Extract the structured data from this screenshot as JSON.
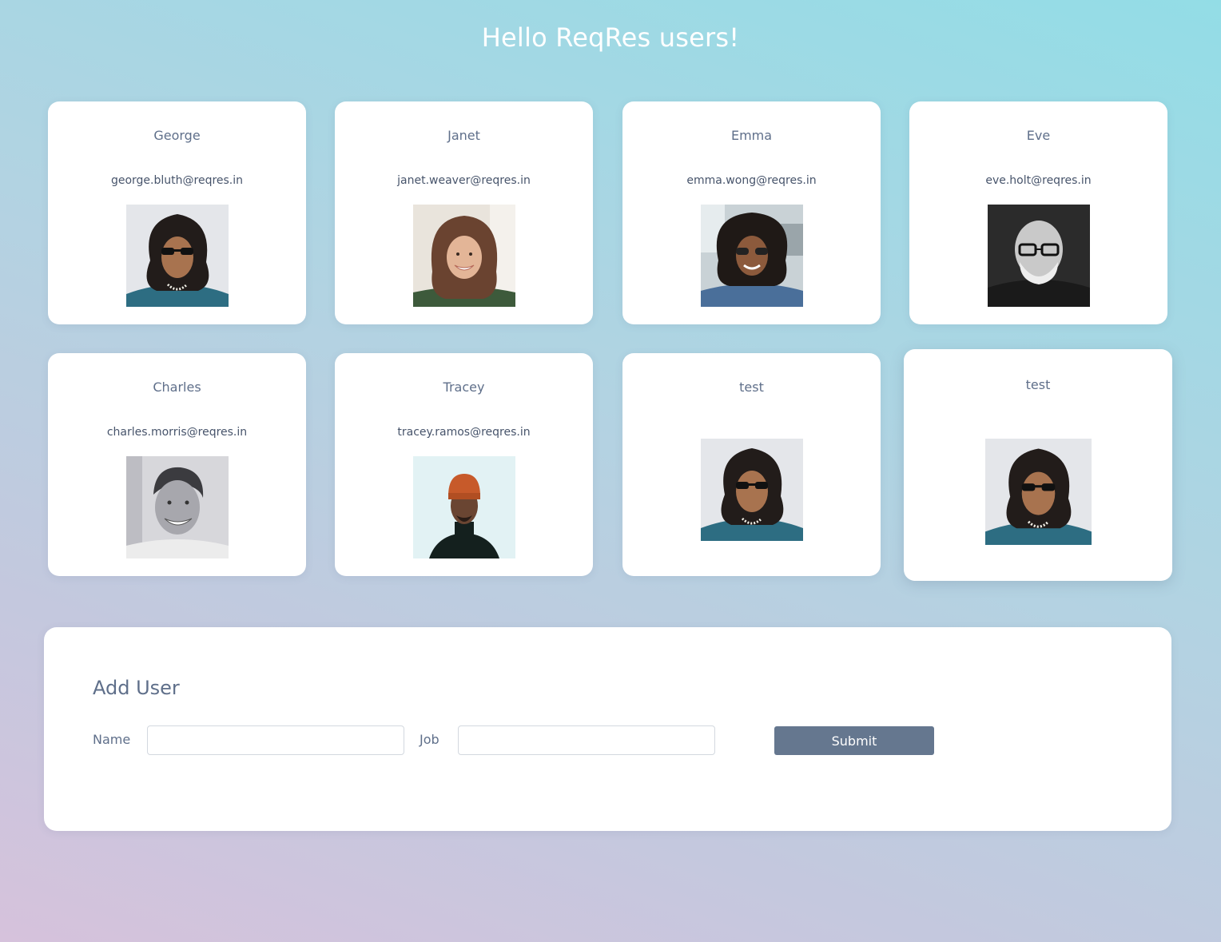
{
  "page": {
    "title": "Hello ReqRes users!"
  },
  "users": [
    {
      "first_name": "George",
      "email": "george.bluth@reqres.in",
      "avatar_icon": "avatar-curly-hair-sunglasses-photo"
    },
    {
      "first_name": "Janet",
      "email": "janet.weaver@reqres.in",
      "avatar_icon": "avatar-smiling-woman-photo"
    },
    {
      "first_name": "Emma",
      "email": "emma.wong@reqres.in",
      "avatar_icon": "avatar-curly-hair-woman-sunglasses-photo"
    },
    {
      "first_name": "Eve",
      "email": "eve.holt@reqres.in",
      "avatar_icon": "avatar-bald-man-glasses-photo"
    },
    {
      "first_name": "Charles",
      "email": "charles.morris@reqres.in",
      "avatar_icon": "avatar-smiling-man-photo"
    },
    {
      "first_name": "Tracey",
      "email": "tracey.ramos@reqres.in",
      "avatar_icon": "avatar-man-beanie-photo"
    },
    {
      "first_name": "test",
      "email": "",
      "avatar_icon": "avatar-curly-hair-sunglasses-photo"
    },
    {
      "first_name": "test",
      "email": "",
      "avatar_icon": "avatar-curly-hair-sunglasses-photo"
    }
  ],
  "add_user_form": {
    "title": "Add User",
    "name_label": "Name",
    "name_value": "",
    "job_label": "Job",
    "job_value": "",
    "submit_label": "Submit"
  },
  "colors": {
    "background_gradient": [
      "#93dde6",
      "#b2d3e2",
      "#c4c8de",
      "#d6c2dc"
    ],
    "card": "#ffffff",
    "text": "#5f6f8a",
    "submit_button": "#65778f"
  }
}
